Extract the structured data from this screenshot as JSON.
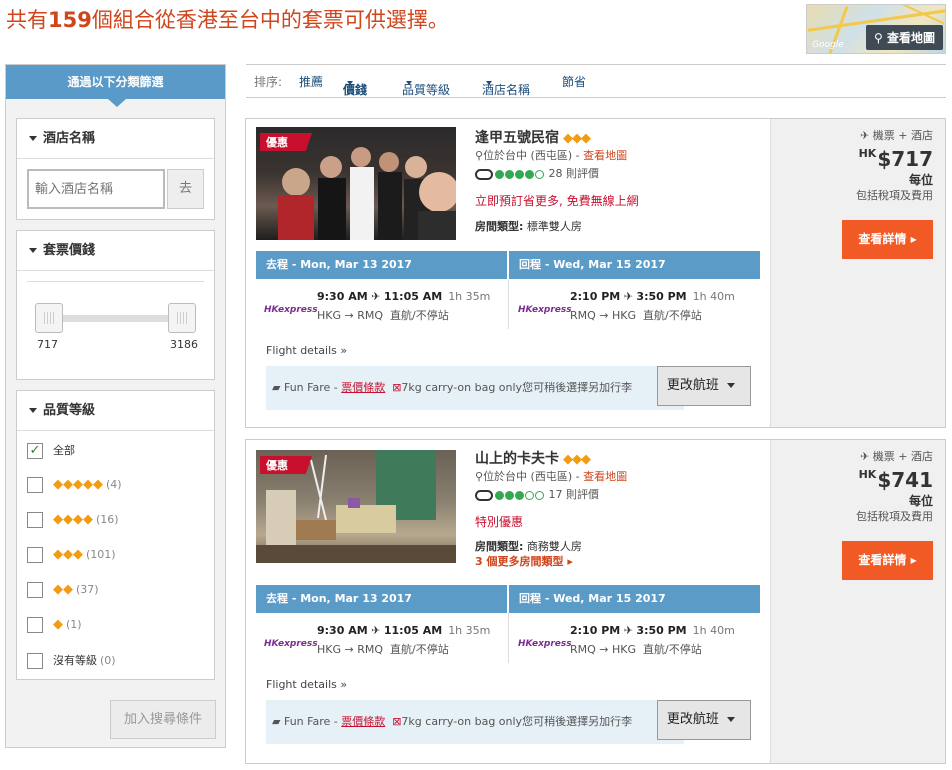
{
  "headline": {
    "prefix": "共有",
    "count": "159",
    "suffix": "個組合從香港至台中的套票可供選擇。"
  },
  "map": {
    "button_label": "查看地圖",
    "google_label": "Google"
  },
  "sidebar": {
    "title": "通過以下分類篩選",
    "hotel_name": {
      "title": "酒店名稱",
      "placeholder": "輸入酒店名稱",
      "go_label": "去"
    },
    "price": {
      "title": "套票價錢",
      "min": "717",
      "max": "3186"
    },
    "quality": {
      "title": "品質等級",
      "options": [
        {
          "label": "全部",
          "count": "",
          "checked": "✓"
        },
        {
          "label": "◆◆◆◆◆",
          "count": "(4)"
        },
        {
          "label": "◆◆◆◆",
          "count": "(16)"
        },
        {
          "label": "◆◆◆",
          "count": "(101)"
        },
        {
          "label": "◆◆",
          "count": "(37)"
        },
        {
          "label": "◆",
          "count": "(1)"
        },
        {
          "label": "沒有等級",
          "count": "(0)"
        }
      ]
    },
    "add_button": "加入搜尋條件"
  },
  "sort": {
    "label": "排序:",
    "items": [
      "推薦",
      "價錢",
      "品質等級",
      "酒店名稱",
      "節省"
    ]
  },
  "results": [
    {
      "badge": "優惠",
      "name": "逢甲五號民宿",
      "stars": "◆◆◆",
      "location": "位於台中 (西屯區)",
      "map_link": "查看地圖",
      "reviews": "28 則評價",
      "promo": "立即預訂省更多, 免費無線上網",
      "room_label": "房間類型:",
      "room_type": "標準雙人房",
      "more_rooms": "",
      "outbound": {
        "header": "去程 - Mon, Mar 13 2017",
        "depart": "9:30 AM",
        "arrive": "11:05 AM",
        "duration": "1h 35m",
        "route": "HKG → RMQ",
        "stops": "直航/不停站"
      },
      "inbound": {
        "header": "回程 - Wed, Mar 15 2017",
        "depart": "2:10 PM",
        "arrive": "3:50 PM",
        "duration": "1h 40m",
        "route": "RMQ → HKG",
        "stops": "直航/不停站"
      },
      "airline": "HKexpress",
      "flight_details": "Flight details",
      "fare": {
        "name": "Fun Fare - ",
        "terms": "票價條款",
        "baggage": "7kg carry-on bag only您可稍後選擇另加行李"
      },
      "change_flight": "更改航班",
      "package": "機票 + 酒店",
      "currency": "HK",
      "price": "$717",
      "per": "每位",
      "tax": "包括稅項及費用",
      "detail_button": "查看詳情"
    },
    {
      "badge": "優惠",
      "name": "山上的卡夫卡",
      "stars": "◆◆◆",
      "location": "位於台中 (西屯區)",
      "map_link": "查看地圖",
      "reviews": "17 則評價",
      "promo": "特別優惠",
      "room_label": "房間類型:",
      "room_type": "商務雙人房",
      "more_rooms": "3 個更多房間類型",
      "outbound": {
        "header": "去程 - Mon, Mar 13 2017",
        "depart": "9:30 AM",
        "arrive": "11:05 AM",
        "duration": "1h 35m",
        "route": "HKG → RMQ",
        "stops": "直航/不停站"
      },
      "inbound": {
        "header": "回程 - Wed, Mar 15 2017",
        "depart": "2:10 PM",
        "arrive": "3:50 PM",
        "duration": "1h 40m",
        "route": "RMQ → HKG",
        "stops": "直航/不停站"
      },
      "airline": "HKexpress",
      "flight_details": "Flight details",
      "fare": {
        "name": "Fun Fare - ",
        "terms": "票價條款",
        "baggage": "7kg carry-on bag only您可稍後選擇另加行李"
      },
      "change_flight": "更改航班",
      "package": "機票 + 酒店",
      "currency": "HK",
      "price": "$741",
      "per": "每位",
      "tax": "包括稅項及費用",
      "detail_button": "查看詳情"
    }
  ]
}
